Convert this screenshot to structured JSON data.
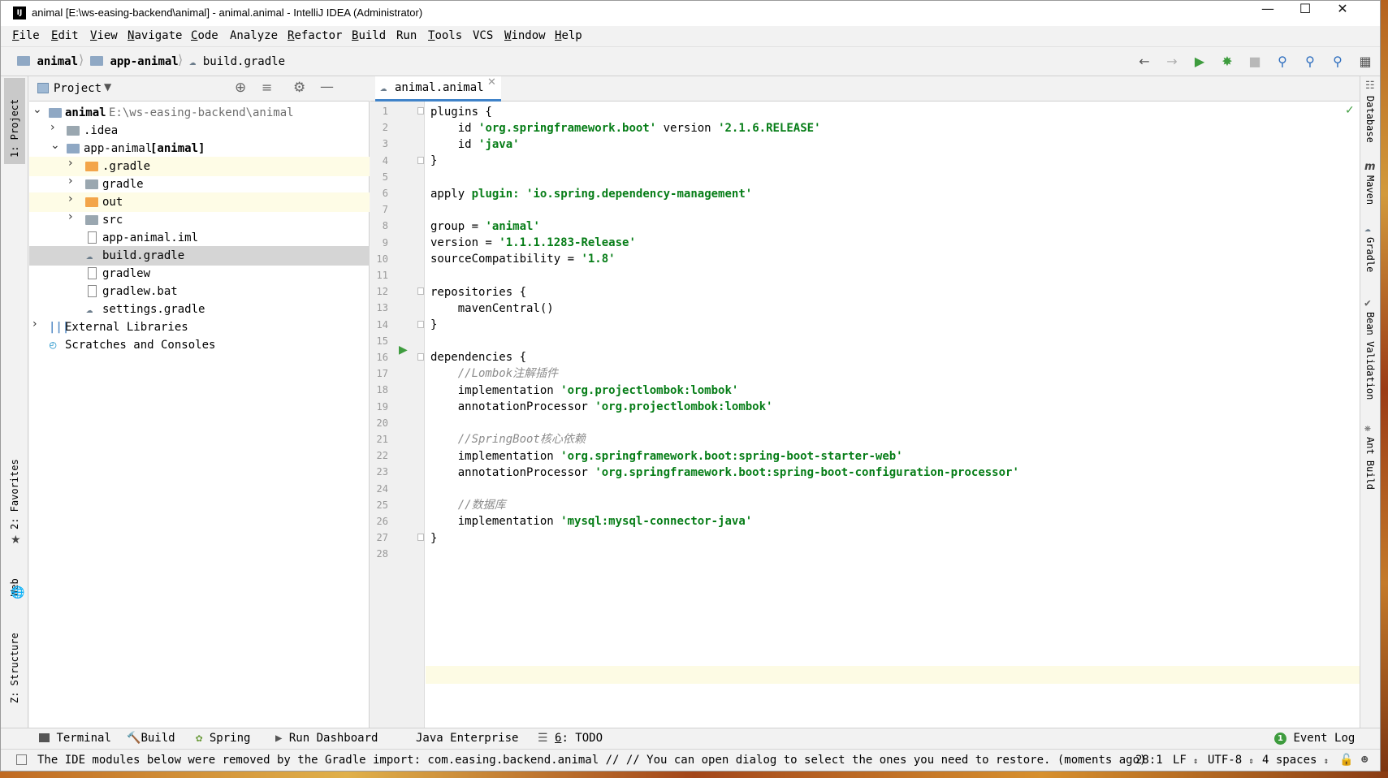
{
  "window": {
    "title": "animal [E:\\ws-easing-backend\\animal] - animal.animal - IntelliJ IDEA (Administrator)",
    "logo_text": "IJ",
    "controls": [
      "minimize-icon",
      "maximize-icon",
      "close-icon"
    ]
  },
  "menu": [
    {
      "mnemonic": "F",
      "rest": "ile"
    },
    {
      "mnemonic": "E",
      "rest": "dit"
    },
    {
      "mnemonic": "V",
      "rest": "iew"
    },
    {
      "mnemonic": "N",
      "rest": "avigate"
    },
    {
      "mnemonic": "C",
      "rest": "ode"
    },
    {
      "mnemonic": "",
      "rest": "Analyze"
    },
    {
      "mnemonic": "R",
      "rest": "efactor"
    },
    {
      "mnemonic": "B",
      "rest": "uild"
    },
    {
      "mnemonic": "",
      "rest": "Run"
    },
    {
      "mnemonic": "T",
      "rest": "ools"
    },
    {
      "mnemonic": "",
      "rest": "VCS"
    },
    {
      "mnemonic": "W",
      "rest": "indow"
    },
    {
      "mnemonic": "H",
      "rest": "elp"
    }
  ],
  "breadcrumb": [
    "animal",
    "app-animal",
    "build.gradle"
  ],
  "toolbar_icons": [
    "back-arrow-icon",
    "forward-arrow-icon",
    "run-icon",
    "debug-icon",
    "stop-icon",
    "search-everywhere-icon",
    "find-icon",
    "replace-icon",
    "project-structure-icon"
  ],
  "left_strip": {
    "project_tab": "1: Project",
    "favorites_tab": "2: Favorites",
    "web_tab": "Web",
    "structure_tab": "Z: Structure"
  },
  "project_panel": {
    "title": "Project",
    "tree": [
      {
        "label": "animal",
        "path": "E:\\ws-easing-backend\\animal"
      },
      {
        "label": ".idea"
      },
      {
        "label": "app-animal",
        "module": "[animal]"
      },
      {
        "label": ".gradle"
      },
      {
        "label": "gradle"
      },
      {
        "label": "out"
      },
      {
        "label": "src"
      },
      {
        "label": "app-animal.iml"
      },
      {
        "label": "build.gradle"
      },
      {
        "label": "gradlew"
      },
      {
        "label": "gradlew.bat"
      },
      {
        "label": "settings.gradle"
      },
      {
        "label": "External Libraries"
      },
      {
        "label": "Scratches and Consoles"
      }
    ]
  },
  "editor": {
    "tab_label": "animal.animal",
    "line_numbers": [
      "1",
      "2",
      "3",
      "4",
      "5",
      "6",
      "7",
      "8",
      "9",
      "10",
      "11",
      "12",
      "13",
      "14",
      "15",
      "16",
      "17",
      "18",
      "19",
      "20",
      "21",
      "22",
      "23",
      "24",
      "25",
      "26",
      "27",
      "28"
    ],
    "code": {
      "l1": "plugins {",
      "l2_id": "id",
      "l2_plugin": "'org.springframework.boot'",
      "l2_version": "version",
      "l2_ver": "'2.1.6.RELEASE'",
      "l3_id": "id",
      "l3_plugin": "'java'",
      "l4": "}",
      "l6_apply": "apply",
      "l6_plugin_kw": "plugin:",
      "l6_value": "'io.spring.dependency-management'",
      "l8_key": "group =",
      "l8_value": "'animal'",
      "l9_key": "version =",
      "l9_value": "'1.1.1.1283-Release'",
      "l10_key": "sourceCompatibility =",
      "l10_value": "'1.8'",
      "l12": "repositories {",
      "l13": "mavenCentral()",
      "l14": "}",
      "l16": "dependencies {",
      "l17": "//Lombok注解插件",
      "l18_kw": "implementation",
      "l18_value": "'org.projectlombok:lombok'",
      "l19_kw": "annotationProcessor",
      "l19_value": "'org.projectlombok:lombok'",
      "l21": "//SpringBoot核心依赖",
      "l22_kw": "implementation",
      "l22_value": "'org.springframework.boot:spring-boot-starter-web'",
      "l23_kw": "annotationProcessor",
      "l23_value": "'org.springframework.boot:spring-boot-configuration-processor'",
      "l25": "//数据库",
      "l26_kw": "implementation",
      "l26_value": "'mysql:mysql-connector-java'",
      "l27": "}"
    }
  },
  "right_strip": [
    "Database",
    "Maven",
    "Gradle",
    "Bean Validation",
    "Ant Build"
  ],
  "tool_windows": {
    "terminal": "Terminal",
    "build": "Build",
    "spring": "Spring",
    "run_dashboard": "Run Dashboard",
    "java_enterprise": "Java Enterprise",
    "todo_num": "6",
    "todo_rest": ": TODO",
    "event_log_count": "1",
    "event_log": "Event Log"
  },
  "status": {
    "message": "The IDE modules below were removed by the Gradle import: com.easing.backend.animal // // You can open dialog to select the ones you need to restore. (moments ago)",
    "position": "28:1",
    "line_sep": "LF",
    "encoding": "UTF-8",
    "indent": "4 spaces"
  },
  "colors": {
    "accent": "#4083c9",
    "string": "#067d17",
    "run_green": "#3e9c3e",
    "selection": "#d5d5d5",
    "highlight": "#fefce6"
  }
}
